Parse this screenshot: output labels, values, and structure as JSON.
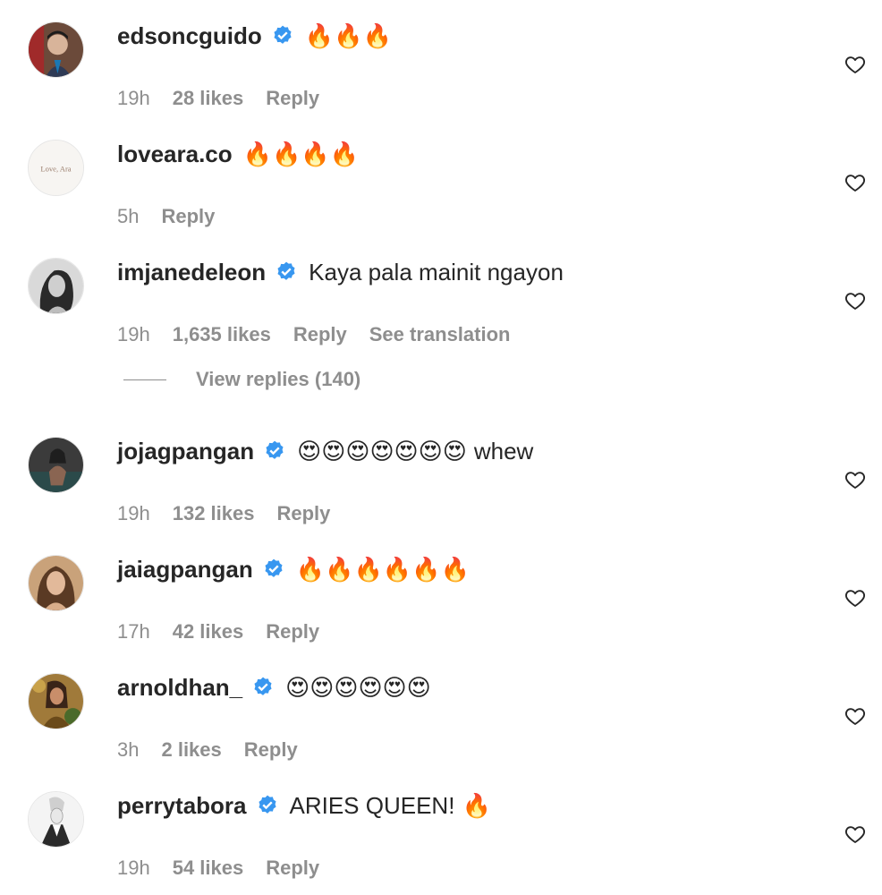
{
  "colors": {
    "text_primary": "#262626",
    "text_secondary": "#8e8e8e",
    "verified_blue": "#3897f0"
  },
  "comments": [
    {
      "username": "edsoncguido",
      "verified": true,
      "text": "",
      "emoji": "🔥🔥🔥",
      "time": "19h",
      "likes": "28 likes",
      "reply_label": "Reply",
      "translation_label": "",
      "avatar_icon": "avatar-photo-icon"
    },
    {
      "username": "loveara.co",
      "verified": false,
      "text": "",
      "emoji": "🔥🔥🔥🔥",
      "time": "5h",
      "likes": "",
      "reply_label": "Reply",
      "translation_label": "",
      "avatar_text": "Love, Ara",
      "avatar_icon": "brand-logo-icon"
    },
    {
      "username": "imjanedeleon",
      "verified": true,
      "text": "Kaya pala mainit ngayon",
      "emoji": "",
      "time": "19h",
      "likes": "1,635 likes",
      "reply_label": "Reply",
      "translation_label": "See translation",
      "avatar_icon": "avatar-photo-icon"
    },
    {
      "username": "jojagpangan",
      "verified": true,
      "text": "",
      "emoji": "😍😍😍😍😍😍😍",
      "text_after": "whew",
      "time": "19h",
      "likes": "132 likes",
      "reply_label": "Reply",
      "translation_label": "",
      "avatar_icon": "avatar-photo-icon"
    },
    {
      "username": "jaiagpangan",
      "verified": true,
      "text": "",
      "emoji": "🔥🔥🔥🔥🔥🔥",
      "time": "17h",
      "likes": "42 likes",
      "reply_label": "Reply",
      "translation_label": "",
      "avatar_icon": "avatar-photo-icon"
    },
    {
      "username": "arnoldhan_",
      "verified": true,
      "text": "",
      "emoji": "😍😍😍😍😍😍",
      "time": "3h",
      "likes": "2 likes",
      "reply_label": "Reply",
      "translation_label": "",
      "avatar_icon": "avatar-photo-icon"
    },
    {
      "username": "perrytabora",
      "verified": true,
      "text": "ARIES QUEEN!",
      "emoji": "🔥",
      "time": "19h",
      "likes": "54 likes",
      "reply_label": "Reply",
      "translation_label": "",
      "avatar_icon": "avatar-photo-icon"
    }
  ],
  "view_replies": {
    "label": "View replies (140)"
  }
}
